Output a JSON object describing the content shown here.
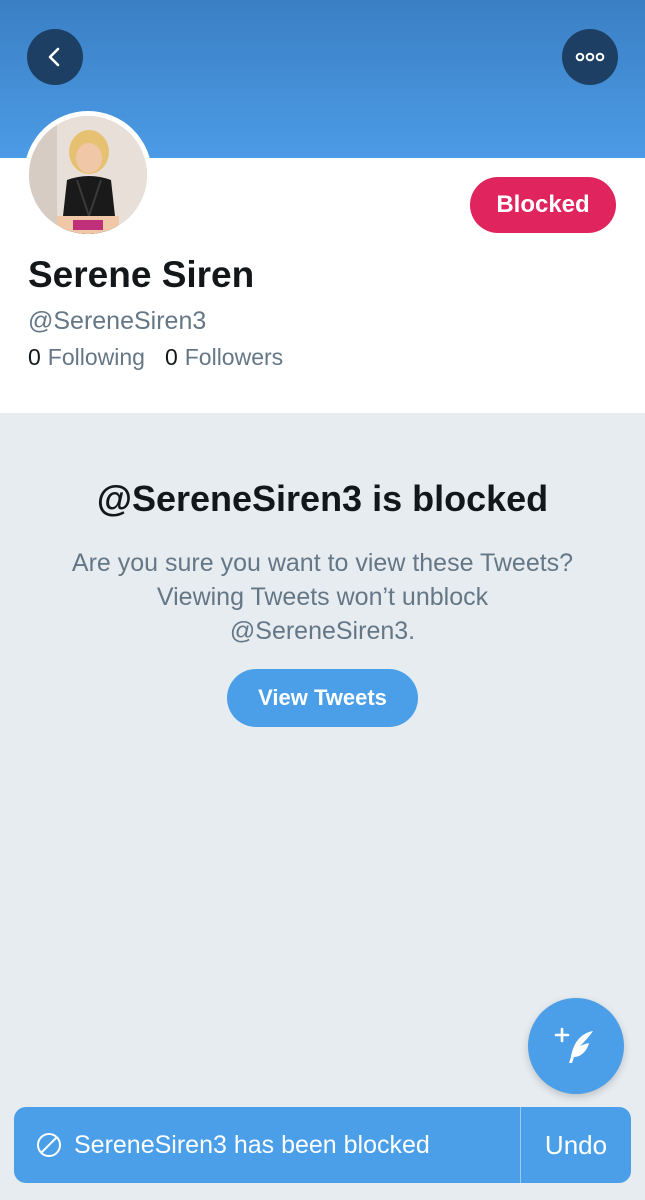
{
  "header": {
    "back_icon": "chevron-left-icon",
    "more_icon": "more-dots-icon"
  },
  "profile": {
    "name": "Serene Siren",
    "handle": "@SereneSiren3",
    "status_button": "Blocked",
    "following_count": "0",
    "following_label": "Following",
    "followers_count": "0",
    "followers_label": "Followers"
  },
  "blocked_notice": {
    "title": "@SereneSiren3 is blocked",
    "message": "Are you sure you want to view these Tweets? Viewing Tweets won’t unblock @SereneSiren3.",
    "button": "View Tweets"
  },
  "compose": {
    "icon": "compose-tweet-icon"
  },
  "toast": {
    "icon": "blocked-icon",
    "message": "SereneSiren3 has been blocked",
    "action": "Undo"
  },
  "colors": {
    "header_top": "#3a7fc4",
    "header_bottom": "#4c9be6",
    "accent_blue": "#4a9fe8",
    "blocked_red": "#e0245e",
    "dark_circle": "#1d3f63",
    "background": "#e6ecf0",
    "text_primary": "#14171a",
    "text_secondary": "#657786"
  }
}
